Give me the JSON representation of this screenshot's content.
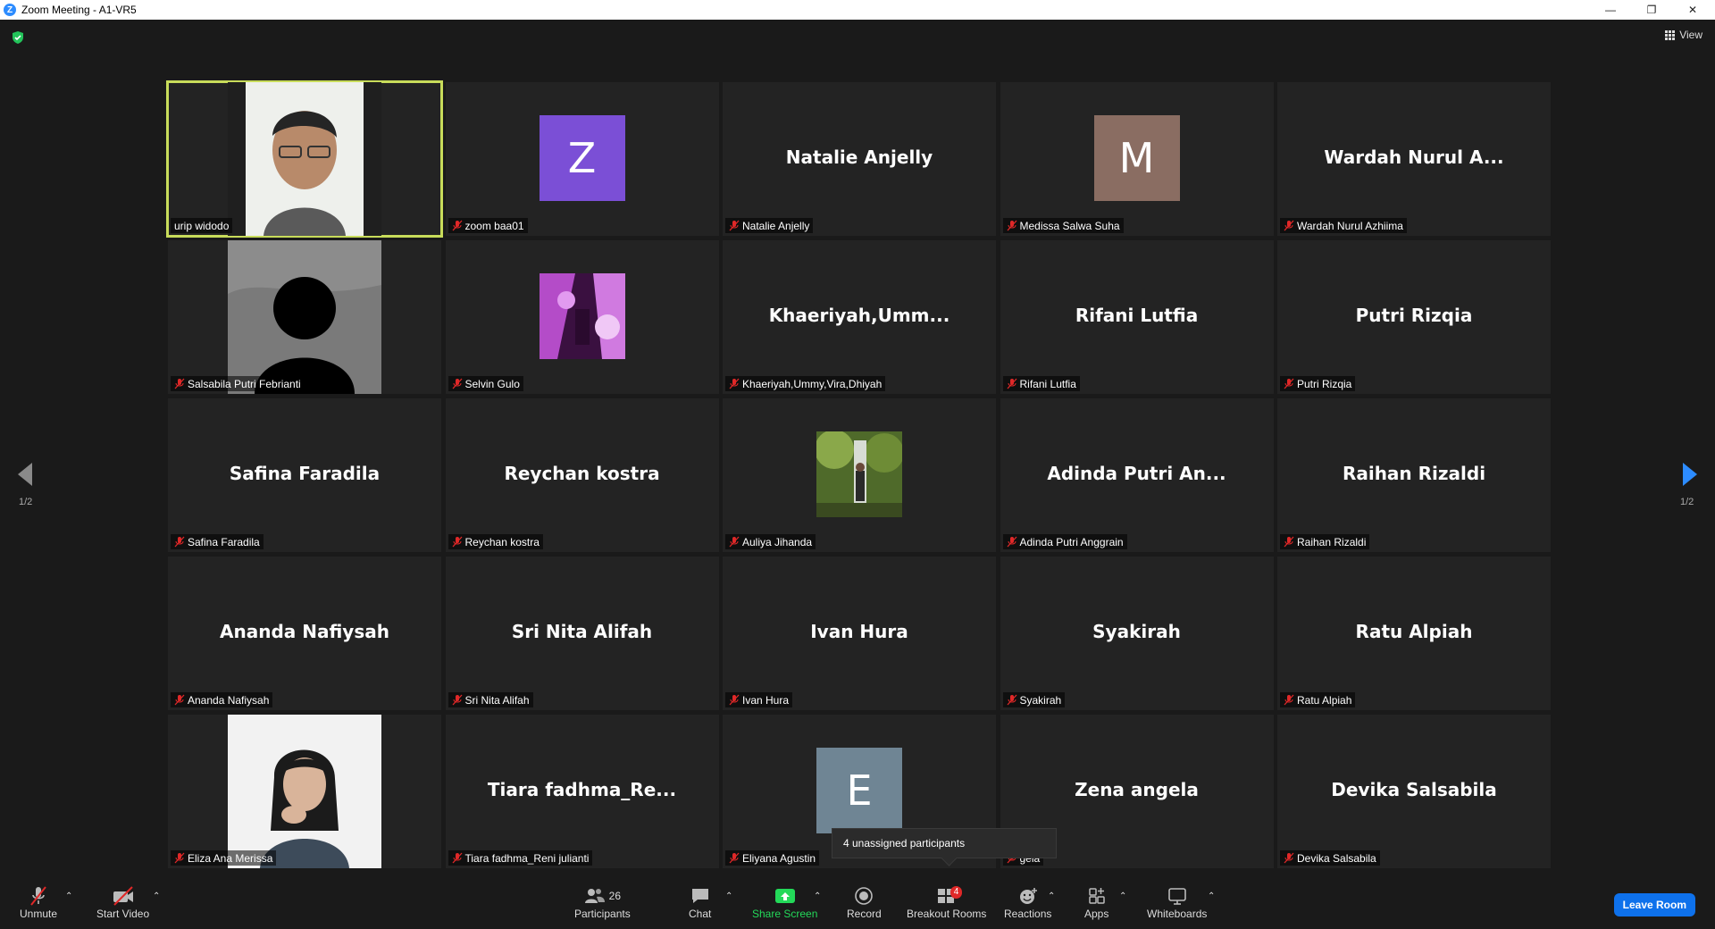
{
  "window": {
    "title": "Zoom Meeting - A1-VR5",
    "logo": "Z"
  },
  "top": {
    "view_label": "View"
  },
  "pager": {
    "left": "1/2",
    "right": "1/2"
  },
  "tiles": [
    {
      "big": "",
      "label": "urip widodo",
      "kind": "video1"
    },
    {
      "big": "",
      "label": "zoom baa01",
      "kind": "avatar",
      "letter": "Z",
      "color": "#7b4fd6"
    },
    {
      "big": "Natalie Anjelly",
      "label": "Natalie Anjelly"
    },
    {
      "big": "",
      "label": "Medissa Salwa Suha",
      "kind": "avatar",
      "letter": "M",
      "color": "#8a6d62"
    },
    {
      "big": "Wardah Nurul A...",
      "label": "Wardah Nurul Azhiima"
    },
    {
      "big": "",
      "label": "Salsabila Putri Febrianti",
      "kind": "silhouette"
    },
    {
      "big": "",
      "label": "Selvin Gulo",
      "kind": "purplepic"
    },
    {
      "big": "Khaeriyah,Umm...",
      "label": "Khaeriyah,Ummy,Vira,Dhiyah"
    },
    {
      "big": "Rifani Lutfia",
      "label": "Rifani Lutfia"
    },
    {
      "big": "Putri Rizqia",
      "label": "Putri Rizqia"
    },
    {
      "big": "Safina Faradila",
      "label": "Safina Faradila"
    },
    {
      "big": "Reychan kostra",
      "label": "Reychan kostra"
    },
    {
      "big": "",
      "label": "Auliya Jihanda",
      "kind": "forestpic"
    },
    {
      "big": "Adinda Putri An...",
      "label": "Adinda Putri Anggrain"
    },
    {
      "big": "Raihan Rizaldi",
      "label": "Raihan Rizaldi"
    },
    {
      "big": "Ananda Nafiysah",
      "label": "Ananda Nafiysah"
    },
    {
      "big": "Sri Nita Alifah",
      "label": "Sri Nita Alifah"
    },
    {
      "big": "Ivan Hura",
      "label": "Ivan Hura"
    },
    {
      "big": "Syakirah",
      "label": "Syakirah"
    },
    {
      "big": "Ratu Alpiah",
      "label": "Ratu Alpiah"
    },
    {
      "big": "",
      "label": "Eliza Ana Merissa",
      "kind": "video2"
    },
    {
      "big": "Tiara  fadhma_Re...",
      "label": "Tiara fadhma_Reni julianti"
    },
    {
      "big": "",
      "label": "Eliyana Agustin",
      "kind": "avatar",
      "letter": "E",
      "color": "#6f8594"
    },
    {
      "big": "Zena angela",
      "label": "gela"
    },
    {
      "big": "Devika Salsabila",
      "label": "Devika Salsabila"
    }
  ],
  "tooltip": "4 unassigned participants",
  "toolbar": {
    "unmute": "Unmute",
    "start_video": "Start Video",
    "participants": "Participants",
    "participants_count": "26",
    "chat": "Chat",
    "share": "Share Screen",
    "record": "Record",
    "breakout": "Breakout Rooms",
    "breakout_badge": "4",
    "reactions": "Reactions",
    "apps": "Apps",
    "whiteboards": "Whiteboards",
    "leave": "Leave Room"
  },
  "colors": {
    "accent": "#0e71eb",
    "share_green": "#23d959",
    "active_border": "#c8dc5a",
    "mute_red": "#e02828"
  }
}
